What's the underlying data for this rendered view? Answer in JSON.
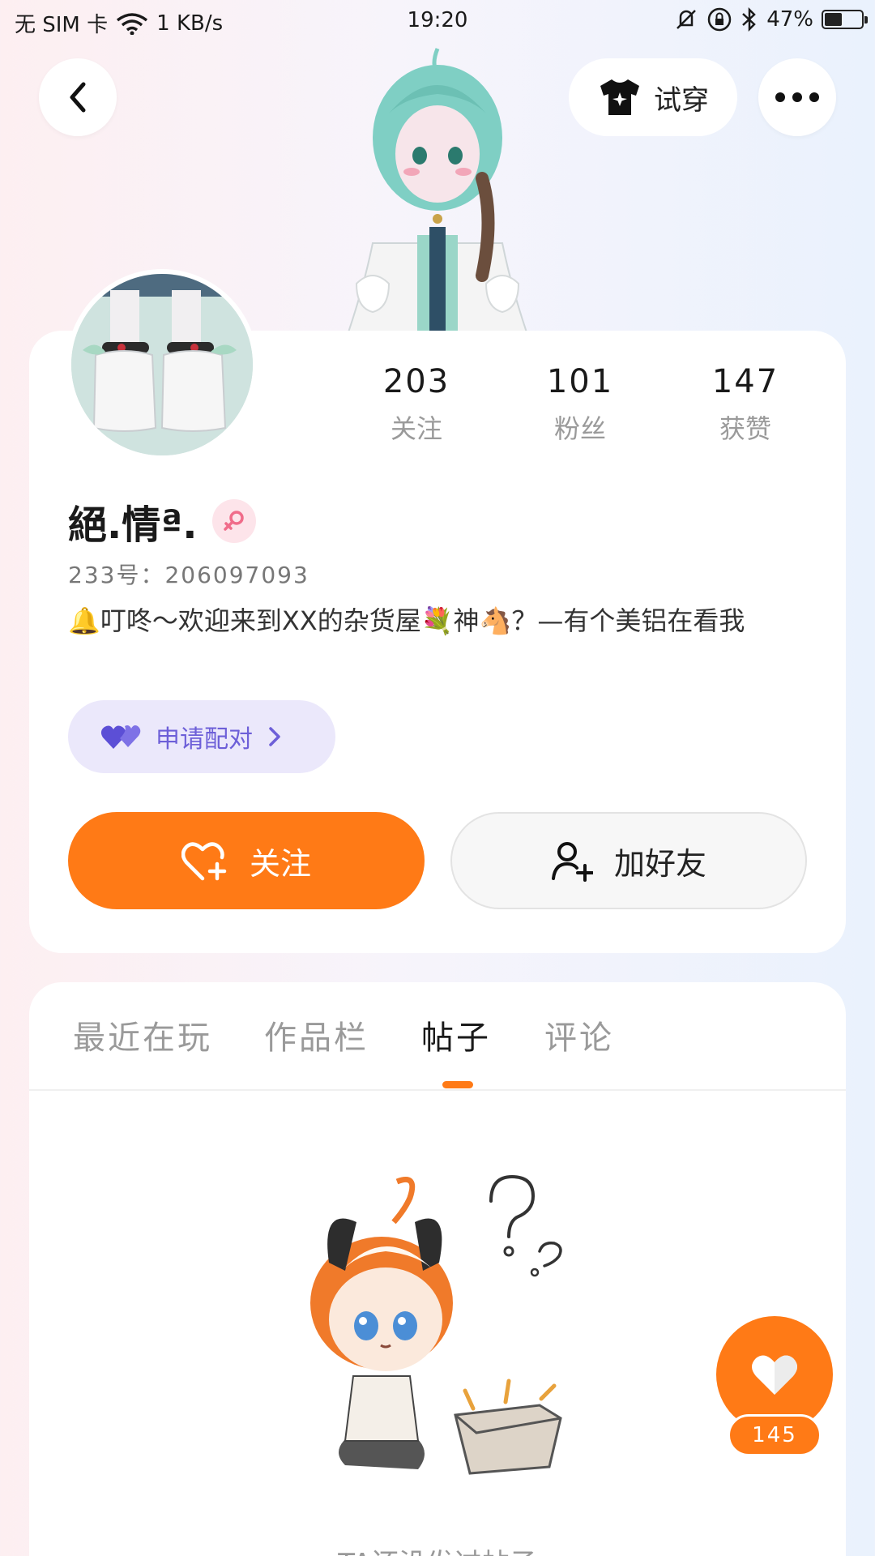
{
  "status_bar": {
    "carrier": "无 SIM 卡",
    "speed": "1 KB/s",
    "time": "19:20",
    "battery": "47%",
    "battery_level": 0.47
  },
  "header": {
    "tryon_label": "试穿"
  },
  "profile": {
    "stats": [
      {
        "value": "203",
        "label": "关注"
      },
      {
        "value": "101",
        "label": "粉丝"
      },
      {
        "value": "147",
        "label": "获赞"
      }
    ],
    "name": "絕.情ª.",
    "uid": "233号：206097093",
    "bio": "🔔叮咚～欢迎来到XX的杂货屋💐神🐴？—有个美铝在看我",
    "pair_label": "申请配对",
    "follow_label": "关注",
    "add_friend_label": "加好友"
  },
  "tabs": [
    {
      "label": "最近在玩"
    },
    {
      "label": "作品栏"
    },
    {
      "label": "帖子"
    },
    {
      "label": "评论"
    }
  ],
  "empty_state": {
    "text": "TA还没发过帖子"
  },
  "fab": {
    "count": "145"
  },
  "colors": {
    "accent": "#ff7a16",
    "pair_bg": "#ebe8fb",
    "pair_text": "#6d5fd8"
  }
}
